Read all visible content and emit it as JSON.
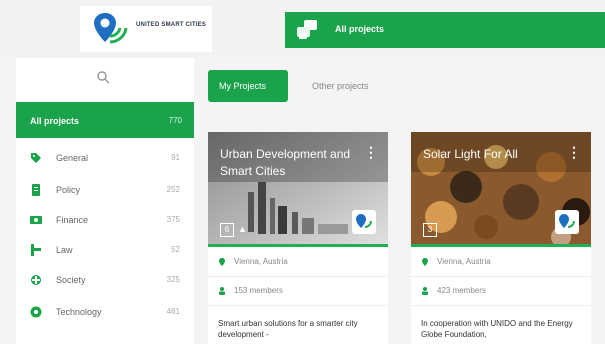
{
  "brand": {
    "name": "UNITED SMART CITIES"
  },
  "header": {
    "title": "All projects"
  },
  "sidebar": {
    "all_projects": {
      "label": "All projects",
      "count": "770"
    },
    "categories": [
      {
        "label": "General",
        "count": "91",
        "icon": "tag-icon"
      },
      {
        "label": "Policy",
        "count": "252",
        "icon": "document-icon"
      },
      {
        "label": "Finance",
        "count": "375",
        "icon": "money-icon"
      },
      {
        "label": "Law",
        "count": "52",
        "icon": "gavel-icon"
      },
      {
        "label": "Society",
        "count": "325",
        "icon": "people-icon"
      },
      {
        "label": "Technology",
        "count": "461",
        "icon": "gear-icon"
      }
    ]
  },
  "tabs": {
    "active": "My Projects",
    "other": "Other projects"
  },
  "cards": [
    {
      "title": "Urban Development and Smart Cities",
      "badge": "6",
      "location": "Vienna, Austria",
      "members": "153 members",
      "description": "Smart urban solutions for a smarter city development -"
    },
    {
      "title": "Solar Light For All",
      "badge": "3",
      "location": "Vienna, Austria",
      "members": "423 members",
      "description": "In cooperation with UNIDO and the Energy Globe Foundation,"
    }
  ],
  "colors": {
    "accent": "#1aa34a",
    "sidebar_bg": "#ffffff",
    "page_bg": "#f4f4f4"
  }
}
